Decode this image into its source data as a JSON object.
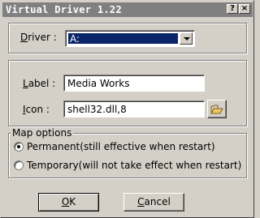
{
  "window": {
    "title": "Virtual Driver 1.22",
    "help_glyph": "?",
    "close_glyph": "×"
  },
  "driver": {
    "label_accel": "D",
    "label_rest": "river",
    "label_colon": ":",
    "selected": "A:"
  },
  "label_field": {
    "label_accel": "L",
    "label_rest": "abel",
    "label_colon": ":",
    "value": "Media Works"
  },
  "icon_field": {
    "label_accel": "I",
    "label_rest": "con",
    "label_colon": ":",
    "value": "shell32.dll,8",
    "browse_icon": "folder-open-icon"
  },
  "map_options": {
    "legend": "Map options",
    "permanent": "Permanent(still effective when restart)",
    "temporary": "Temporary(will not take effect when restart)",
    "selected": "permanent"
  },
  "buttons": {
    "ok_accel": "O",
    "ok_rest": "K",
    "cancel_accel": "C",
    "cancel_rest": "ancel"
  }
}
